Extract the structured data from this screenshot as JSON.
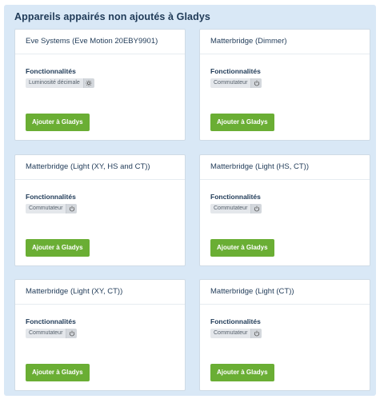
{
  "panel": {
    "title": "Appareils appairés non ajoutés à Gladys"
  },
  "cards": [
    {
      "title": "Eve Systems (Eve Motion 20EBY9901)",
      "section_label": "Fonctionnalités",
      "feature": "Luminosité décimale",
      "feature_icon": "sun-icon",
      "button": "Ajouter à Gladys"
    },
    {
      "title": "Matterbridge (Dimmer)",
      "section_label": "Fonctionnalités",
      "feature": "Commutateur",
      "feature_icon": "power-icon",
      "button": "Ajouter à Gladys"
    },
    {
      "title": "Matterbridge (Light (XY, HS and CT))",
      "section_label": "Fonctionnalités",
      "feature": "Commutateur",
      "feature_icon": "power-icon",
      "button": "Ajouter à Gladys"
    },
    {
      "title": "Matterbridge (Light (HS, CT))",
      "section_label": "Fonctionnalités",
      "feature": "Commutateur",
      "feature_icon": "power-icon",
      "button": "Ajouter à Gladys"
    },
    {
      "title": "Matterbridge (Light (XY, CT))",
      "section_label": "Fonctionnalités",
      "feature": "Commutateur",
      "feature_icon": "power-icon",
      "button": "Ajouter à Gladys"
    },
    {
      "title": "Matterbridge (Light (CT))",
      "section_label": "Fonctionnalités",
      "feature": "Commutateur",
      "feature_icon": "power-icon",
      "button": "Ajouter à Gladys"
    }
  ],
  "colors": {
    "panel_bg": "#d9e8f6",
    "button_green": "#6aae34",
    "title_text": "#1f3a57"
  }
}
